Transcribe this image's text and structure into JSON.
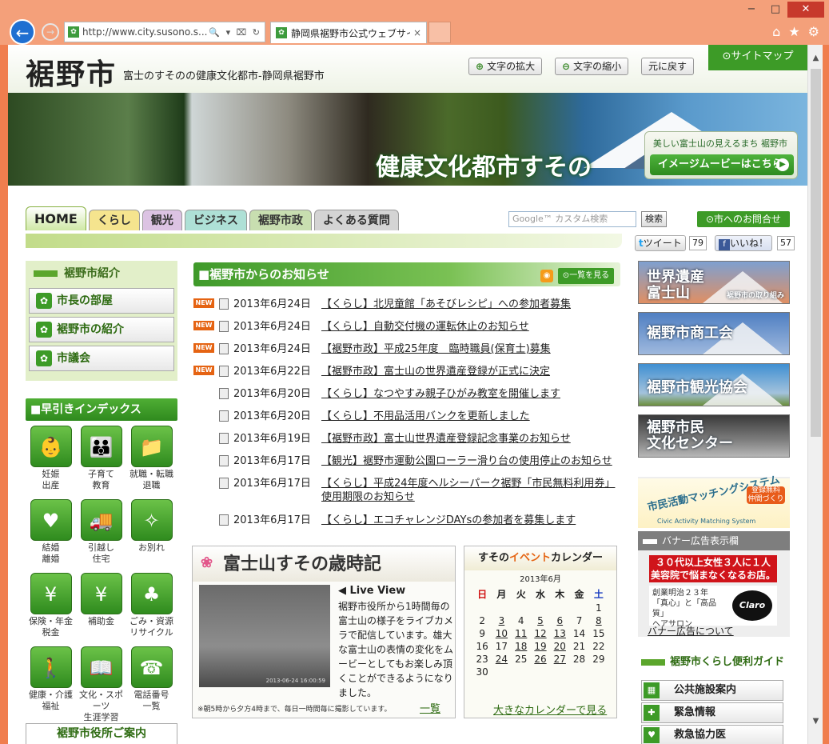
{
  "browser": {
    "url": "http://www.city.susono.s...",
    "tab_title": "静岡県裾野市公式ウェブサイ...",
    "tab_close": "×",
    "back": "←",
    "forward": "→",
    "minimize": "−",
    "maximize": "□",
    "close": "✕",
    "home_icon": "⌂",
    "star_icon": "★",
    "gear_icon": "⚙",
    "addr_tools": "🔍 ▾ ⌧ ↻",
    "favicon": "✿"
  },
  "header": {
    "logo": "裾野市",
    "tagline": "富士のすそのの健康文化都市-静岡県裾野市",
    "zoom_in": "文字の拡大",
    "zoom_out": "文字の縮小",
    "reset": "元に戻す",
    "sitemap": "サイトマップ"
  },
  "hero": {
    "title": "健康文化都市すその",
    "box_small": "美しい富士山の見えるまち 裾野市",
    "box_button": "イメージムービーはこちら"
  },
  "nav": {
    "tabs": [
      "HOME",
      "くらし",
      "観光",
      "ビジネス",
      "裾野市政",
      "よくある質問"
    ],
    "search_placeholder": "Google™ カスタム検索",
    "search_button": "検索",
    "contact": "市へのお問合せ",
    "tweet": "ツイート",
    "tweet_count": "79",
    "like": "いいね！",
    "like_count": "57"
  },
  "intro": {
    "heading": "裾野市紹介",
    "items": [
      "市長の部屋",
      "裾野市の紹介",
      "市議会"
    ]
  },
  "index": {
    "heading": "■早引きインデックス",
    "items": [
      {
        "label": "妊娠\n出産",
        "icon": "👶"
      },
      {
        "label": "子育て\n教育",
        "icon": "👪"
      },
      {
        "label": "就職・転職\n退職",
        "icon": "📁"
      },
      {
        "label": "結婚\n離婚",
        "icon": "♥"
      },
      {
        "label": "引越し\n住宅",
        "icon": "🚚"
      },
      {
        "label": "お別れ",
        "icon": "✧"
      },
      {
        "label": "保険・年金\n税金",
        "icon": "¥"
      },
      {
        "label": "補助金",
        "icon": "¥"
      },
      {
        "label": "ごみ・資源\nリサイクル",
        "icon": "♣"
      },
      {
        "label": "健康・介護\n福祉",
        "icon": "🚶"
      },
      {
        "label": "文化・スポーツ\n生涯学習",
        "icon": "📖"
      },
      {
        "label": "電話番号\n一覧",
        "icon": "☎"
      }
    ],
    "office": "裾野市役所ご案内"
  },
  "news": {
    "heading": "■裾野市からのお知らせ",
    "list_button": "一覧を見る",
    "new_label": "NEW",
    "items": [
      {
        "new": true,
        "date": "2013年6月24日",
        "title": "【くらし】北児童館「あそびレシピ」への参加者募集"
      },
      {
        "new": true,
        "date": "2013年6月24日",
        "title": "【くらし】自動交付機の運転休止のお知らせ"
      },
      {
        "new": true,
        "date": "2013年6月24日",
        "title": "【裾野市政】平成25年度　臨時職員(保育士)募集"
      },
      {
        "new": true,
        "date": "2013年6月22日",
        "title": "【裾野市政】富士山の世界遺産登録が正式に決定"
      },
      {
        "new": false,
        "date": "2013年6月20日",
        "title": "【くらし】なつやすみ親子ひがみ教室を開催します"
      },
      {
        "new": false,
        "date": "2013年6月20日",
        "title": "【くらし】不用品活用バンクを更新しました"
      },
      {
        "new": false,
        "date": "2013年6月19日",
        "title": "【裾野市政】富士山世界遺産登録記念事業のお知らせ"
      },
      {
        "new": false,
        "date": "2013年6月17日",
        "title": "【観光】裾野市運動公園ローラー滑り台の使用停止のお知らせ"
      },
      {
        "new": false,
        "date": "2013年6月17日",
        "title": "【くらし】平成24年度ヘルシーパーク裾野「市民無料利用券」使用期限のお知らせ"
      },
      {
        "new": false,
        "date": "2013年6月17日",
        "title": "【くらし】エコチャレンジDAYsの参加者を募集します"
      }
    ]
  },
  "saijiki": {
    "title": "富士山すその歳時記",
    "flower": "❀",
    "live_view": "◀ Live View",
    "cam_timestamp": "2013-06-24 16:00:59",
    "text": "裾野市役所から1時間毎の富士山の様子をライブカメラで配信しています。雄大な富士山の表情の変化をムービーとしてもお楽しみ頂くことができるようになりました。",
    "note": "※朝5時から夕方4時まで、毎日一時間毎に撮影しています。",
    "more": "一覧"
  },
  "calendar": {
    "title_pre": "すその",
    "title_hl": "イベント",
    "title_post": "カレンダー",
    "month": "2013年6月",
    "weekdays": [
      "日",
      "月",
      "火",
      "水",
      "木",
      "金",
      "土"
    ],
    "days": [
      "",
      "",
      "",
      "",
      "",
      "",
      "1",
      "2",
      "3",
      "4",
      "5",
      "6",
      "7",
      "8",
      "9",
      "10",
      "11",
      "12",
      "13",
      "14",
      "15",
      "16",
      "17",
      "18",
      "19",
      "20",
      "21",
      "22",
      "23",
      "24",
      "25",
      "26",
      "27",
      "28",
      "29",
      "30"
    ],
    "event_days": [
      "3",
      "5",
      "6",
      "8",
      "10",
      "11",
      "12",
      "13",
      "18",
      "19",
      "20",
      "24",
      "26",
      "27"
    ],
    "more": "大きなカレンダーで見る"
  },
  "banners": [
    {
      "text": "世界遺産\n富士山",
      "sub": "裾野市の取り組み"
    },
    {
      "text": "裾野市商工会",
      "sub": ""
    },
    {
      "text": "裾野市観光協会",
      "sub": ""
    },
    {
      "text": "裾野市民\n文化センター",
      "sub": ""
    }
  ],
  "civic": {
    "title": "市民活動マッチングシステム",
    "tag": "登録無料\n仲間づくり",
    "en": "Civic Activity Matching System"
  },
  "ad": {
    "heading": "バナー広告表示欄",
    "red": "３０代以上女性３人に１人\n美容院で悩まなくなるお店。",
    "white": "創業明治２３年\n「真心」と「高品質」\nヘアサロン",
    "logo": "Claro",
    "link": "バナー広告について"
  },
  "guide": {
    "heading": "裾野市くらし便利ガイド",
    "items": [
      "公共施設案内",
      "緊急情報",
      "救急協力医"
    ]
  }
}
